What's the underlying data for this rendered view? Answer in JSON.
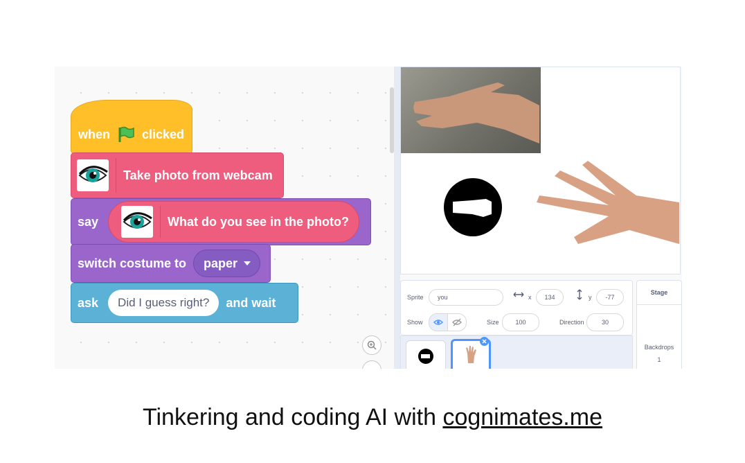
{
  "code": {
    "hat": {
      "when": "when",
      "clicked": "clicked"
    },
    "photo_block": {
      "label": "Take photo from webcam"
    },
    "say_block": {
      "say": "say",
      "question": "What do you see in the photo?"
    },
    "costume_block": {
      "label": "switch costume to",
      "value": "paper"
    },
    "ask_block": {
      "ask": "ask",
      "text": "Did I guess right?",
      "wait": "and wait"
    }
  },
  "sprite_info": {
    "sprite_label": "Sprite",
    "sprite_name": "you",
    "x_label": "x",
    "x_value": "134",
    "y_label": "y",
    "y_value": "-77",
    "show_label": "Show",
    "size_label": "Size",
    "size_value": "100",
    "direction_label": "Direction",
    "direction_value": "30"
  },
  "stage_panel": {
    "title": "Stage",
    "backdrops_label": "Backdrops",
    "backdrops_count": "1"
  },
  "caption": {
    "text": "Tinkering and coding AI with ",
    "link": "cognimates.me"
  },
  "colors": {
    "events": "#ffbf29",
    "extension": "#ee5d7e",
    "looks": "#9a66cc",
    "sensing": "#5cb1d6"
  }
}
